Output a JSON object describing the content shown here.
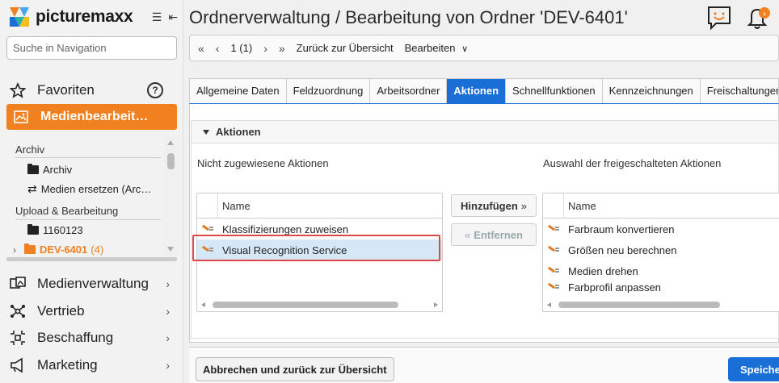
{
  "app": {
    "brand": "picturemaxx",
    "search_placeholder": "Suche in Navigation"
  },
  "sidebar": {
    "favorites": "Favoriten",
    "active_item": "Medienbearbeit…",
    "tree": {
      "archive_header": "Archiv",
      "archive_items": [
        {
          "label": "Archiv"
        },
        {
          "label": "Medien ersetzen (Arc…"
        }
      ],
      "upload_header": "Upload & Bearbeitung",
      "upload_items": [
        {
          "label": "1160123"
        },
        {
          "label": "DEV-6401",
          "count": "(4)"
        }
      ]
    },
    "menu": [
      {
        "label": "Medienverwaltung"
      },
      {
        "label": "Vertrieb"
      },
      {
        "label": "Beschaffung"
      },
      {
        "label": "Marketing"
      }
    ]
  },
  "header": {
    "title": "Ordnerverwaltung / Bearbeitung von Ordner 'DEV-6401'"
  },
  "toolbar": {
    "page": "1 (1)",
    "back": "Zurück zur Übersicht",
    "edit": "Bearbeiten"
  },
  "tabs": [
    {
      "label": "Allgemeine Daten"
    },
    {
      "label": "Feldzuordnung"
    },
    {
      "label": "Arbeitsordner"
    },
    {
      "label": "Aktionen",
      "active": true
    },
    {
      "label": "Schnellfunktionen"
    },
    {
      "label": "Kennzeichnungen"
    },
    {
      "label": "Freischaltungen"
    }
  ],
  "section": {
    "title": "Aktionen",
    "left_label": "Nicht zugewiesene Aktionen",
    "right_label": "Auswahl der freigeschalteten Aktionen",
    "column_name": "Name",
    "left_rows": [
      {
        "label": "Klassifizierungen zuweisen"
      },
      {
        "label": "Visual Recognition Service",
        "selected": true
      }
    ],
    "right_rows": [
      {
        "label": "Farbraum konvertieren"
      },
      {
        "label": "Größen neu berechnen"
      },
      {
        "label": "Medien drehen"
      },
      {
        "label": "Farbprofil anpassen"
      }
    ],
    "add_button": "Hinzufügen",
    "remove_button": "Entfernen"
  },
  "footer": {
    "cancel": "Abbrechen und zurück zur Übersicht",
    "save": "Speichern"
  },
  "colors": {
    "accent_orange": "#f08020",
    "primary_blue": "#1a6fd6",
    "selection": "#d6e8f8",
    "highlight_red": "#e04848"
  }
}
